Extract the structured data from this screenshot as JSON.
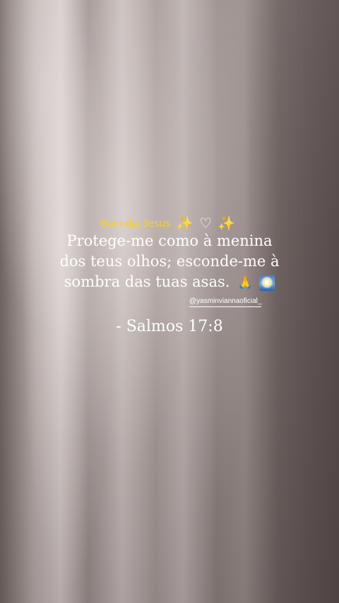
{
  "background": {
    "description": "soft pinkish-gray curtain fabric",
    "colors": [
      "#c9bfbd",
      "#8e8280",
      "#574c4b"
    ]
  },
  "greeting": {
    "text": "Bom-dia Jesus",
    "color": "#f7d21a",
    "emojis": [
      "sparkles-icon",
      "white-heart-icon",
      "sparkles-icon"
    ]
  },
  "verse": {
    "lines": [
      "Protege-me como à menina",
      "dos teus olhos; esconde-me à",
      "sombra das tuas asas."
    ],
    "trailing_emojis": [
      "praying-hands-icon",
      "night-sky-icon"
    ]
  },
  "handle": "@yasminviannaoficial_",
  "reference": "- Salmos 17:8"
}
